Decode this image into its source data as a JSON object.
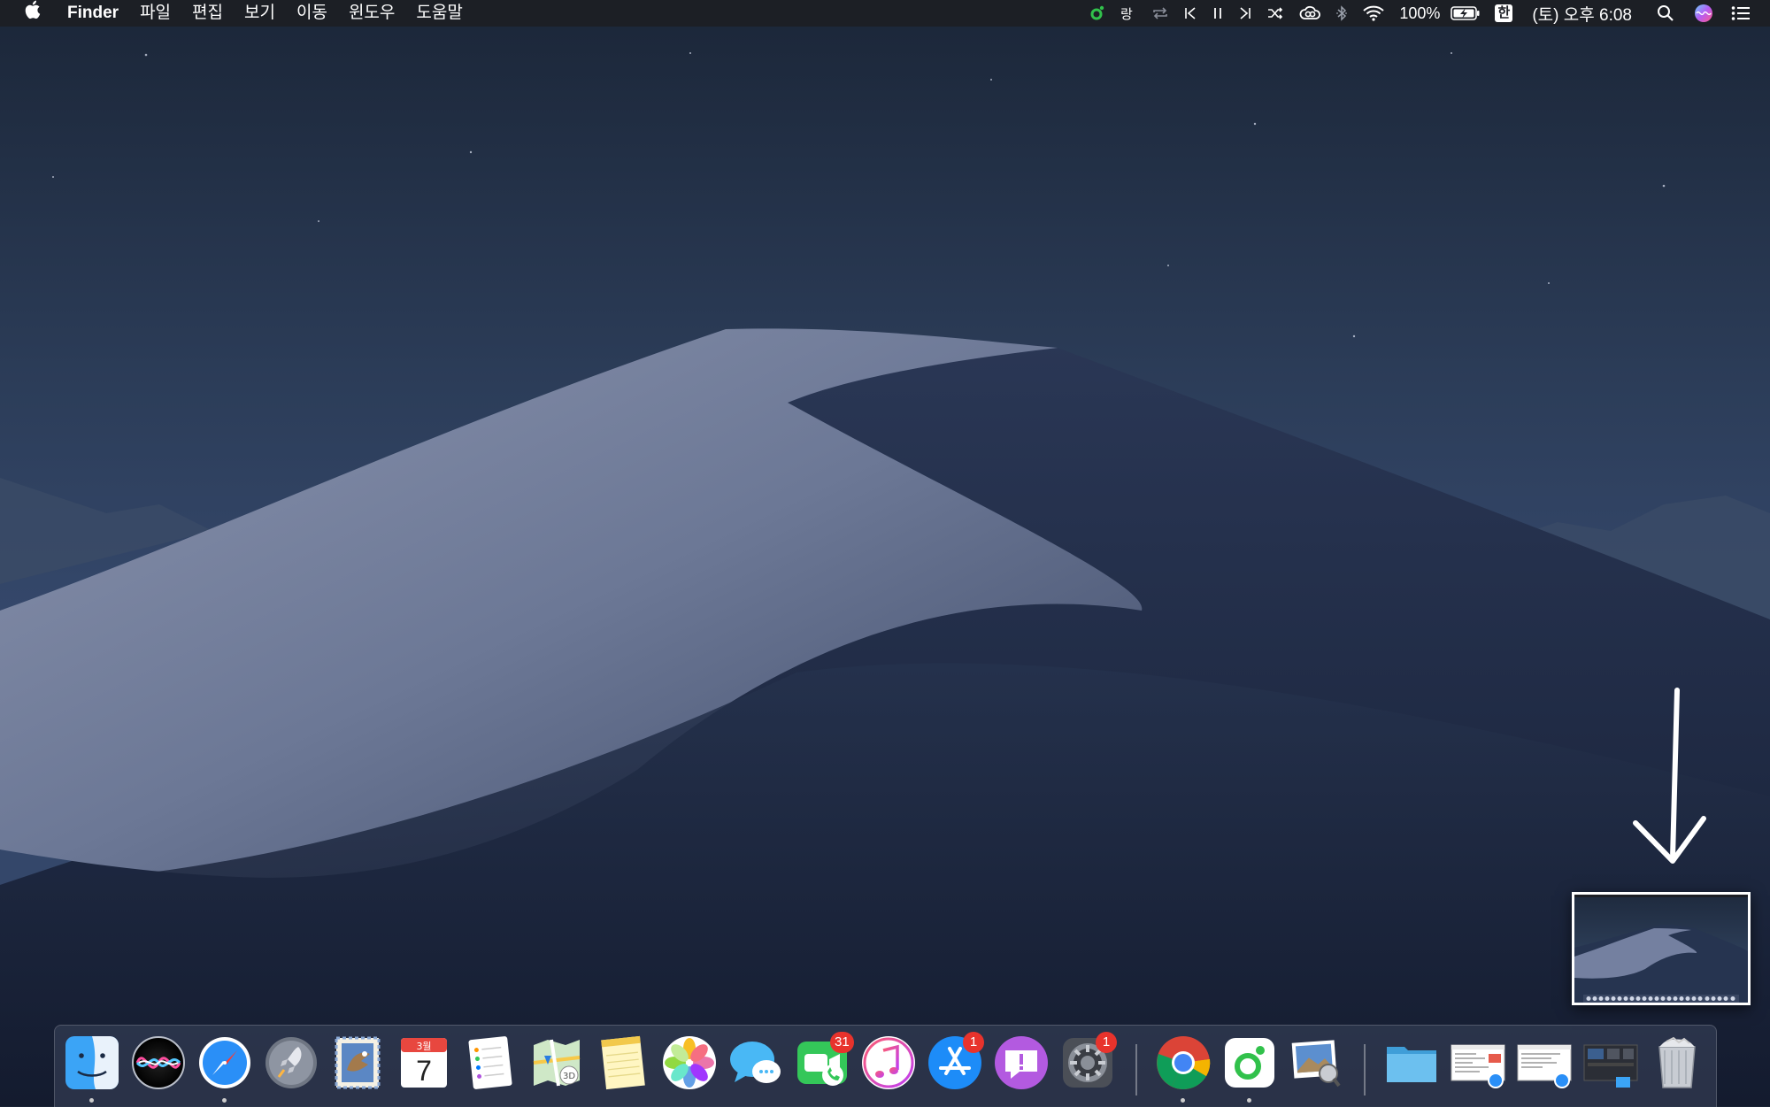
{
  "menubar": {
    "app_name": "Finder",
    "menus": [
      "파일",
      "편집",
      "보기",
      "이동",
      "윈도우",
      "도움말"
    ],
    "battery_percent": "100%",
    "input_method": "한",
    "clock": "(토) 오후 6:08",
    "status_icons": [
      "music-app-icon",
      "lyrics-icon",
      "repeat-icon",
      "previous-track-icon",
      "pause-icon",
      "next-track-icon",
      "shuffle-icon",
      "creative-cloud-icon",
      "bluetooth-icon",
      "wifi-icon",
      "battery-icon",
      "spotlight-search-icon",
      "siri-icon",
      "notification-center-icon"
    ]
  },
  "desktop": {
    "wallpaper": "mojave-night-dunes",
    "annotation": "down-arrow-icon"
  },
  "screenshot_thumbnail": {
    "description_icon": "screenshot-preview-thumbnail"
  },
  "dock": {
    "apps": [
      {
        "name": "Finder",
        "icon": "finder-icon",
        "running": true
      },
      {
        "name": "Siri",
        "icon": "siri-icon",
        "running": false
      },
      {
        "name": "Safari",
        "icon": "safari-icon",
        "running": true
      },
      {
        "name": "Launchpad",
        "icon": "launchpad-icon",
        "running": false
      },
      {
        "name": "Mail",
        "icon": "mail-icon",
        "running": false
      },
      {
        "name": "Calendar",
        "icon": "calendar-icon",
        "running": false,
        "month": "3월",
        "day": "7"
      },
      {
        "name": "Reminders",
        "icon": "reminders-icon",
        "running": false
      },
      {
        "name": "Maps",
        "icon": "maps-icon",
        "running": false
      },
      {
        "name": "Notes",
        "icon": "notes-icon",
        "running": false
      },
      {
        "name": "Photos",
        "icon": "photos-icon",
        "running": false
      },
      {
        "name": "Messages",
        "icon": "messages-icon",
        "running": false
      },
      {
        "name": "FaceTime",
        "icon": "facetime-icon",
        "running": false,
        "badge": "31"
      },
      {
        "name": "iTunes",
        "icon": "itunes-icon",
        "running": false
      },
      {
        "name": "App Store",
        "icon": "app-store-icon",
        "running": false,
        "badge": "1"
      },
      {
        "name": "Feedback Assistant",
        "icon": "feedback-assistant-icon",
        "running": false
      },
      {
        "name": "System Preferences",
        "icon": "system-preferences-icon",
        "running": false,
        "badge": "1"
      },
      {
        "name": "Chrome",
        "icon": "chrome-icon",
        "running": true
      },
      {
        "name": "Music",
        "icon": "music-app-icon",
        "running": true
      },
      {
        "name": "Preview",
        "icon": "preview-icon",
        "running": false
      },
      {
        "name": "Downloads",
        "icon": "folder-icon",
        "running": false
      },
      {
        "name": "Document 1",
        "icon": "document-thumbnail-icon",
        "running": false
      },
      {
        "name": "Document 2",
        "icon": "document-thumbnail-icon",
        "running": false
      },
      {
        "name": "Screenshot",
        "icon": "screen-thumbnail-icon",
        "running": false
      },
      {
        "name": "Trash",
        "icon": "trash-icon",
        "running": false
      }
    ]
  },
  "colors": {
    "menubar_bg": "#1c1e24",
    "badge": "#e8332c",
    "accent_green": "#31c14b"
  }
}
